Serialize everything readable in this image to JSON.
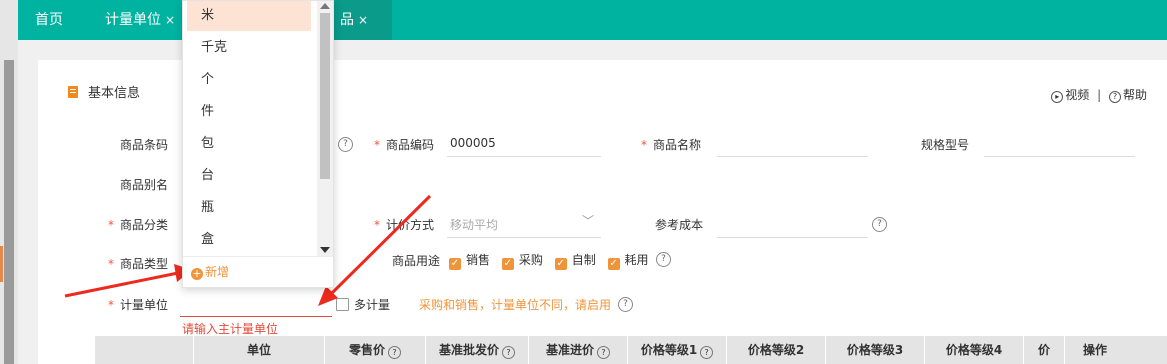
{
  "nav": {
    "tabs": [
      {
        "label": "首页"
      },
      {
        "label": "计量单位",
        "close": "×"
      },
      {
        "label": "品",
        "close": "×"
      }
    ]
  },
  "section": {
    "title": "基本信息"
  },
  "help": {
    "video": "视频",
    "separator": "|",
    "help": "帮助"
  },
  "form": {
    "barcode_label": "商品条码",
    "code_label": "商品编码",
    "code_value": "000005",
    "name_label": "商品名称",
    "spec_label": "规格型号",
    "alias_label": "商品别名",
    "category_label": "商品分类",
    "pricing_label": "计价方式",
    "pricing_placeholder": "移动平均",
    "refcost_label": "参考成本",
    "type_label": "商品类型",
    "usage_label": "商品用途",
    "usage_options": [
      "销售",
      "采购",
      "自制",
      "耗用"
    ],
    "unit_label": "计量单位",
    "multi_unit_label": "多计量",
    "multi_unit_hint": "采购和销售，计量单位不同，请启用",
    "unit_error": "请输入主计量单位",
    "required_mark": "*",
    "qmark": "?",
    "check": "✓"
  },
  "table": {
    "headers": [
      "单位",
      "零售价",
      "基准批发价",
      "基准进价",
      "价格等级1",
      "价格等级2",
      "价格等级3",
      "价格等级4",
      "价",
      "操作"
    ]
  },
  "dropdown": {
    "items": [
      "米",
      "千克",
      "个",
      "件",
      "包",
      "台",
      "瓶",
      "盒"
    ],
    "selected_index": 0,
    "add_label": "新增",
    "add_icon": "+"
  },
  "colors": {
    "nav": "#00b3a1",
    "accent": "#f0943a",
    "error": "#e04b3a",
    "arrow": "#ee2a1e"
  }
}
